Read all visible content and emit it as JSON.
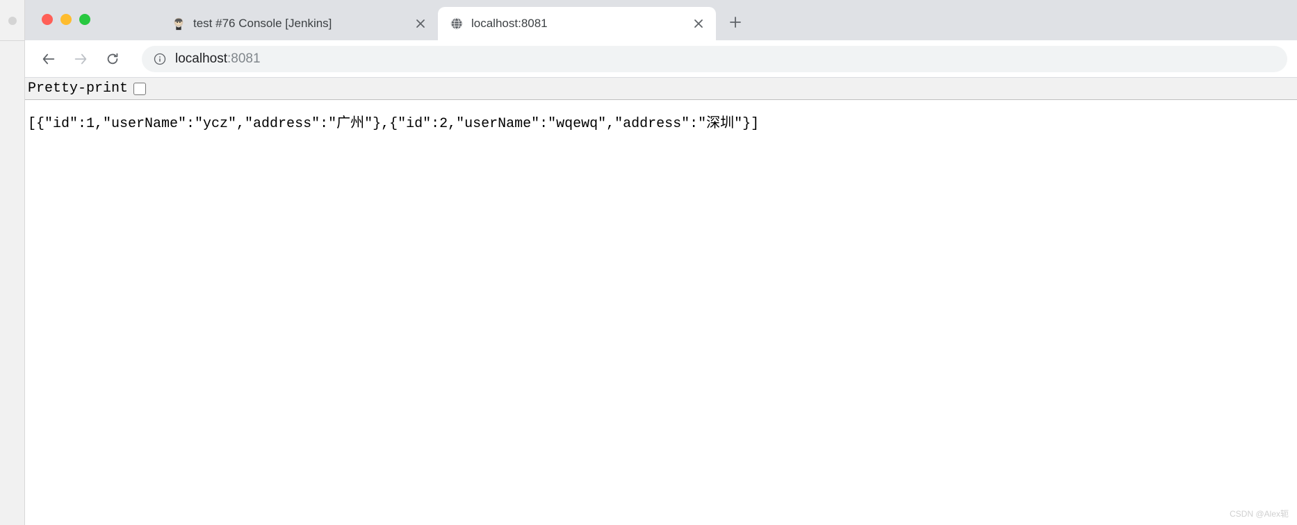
{
  "tabs": [
    {
      "title": "test #76 Console [Jenkins]",
      "active": false,
      "favicon_name": "jenkins-icon"
    },
    {
      "title": "localhost:8081",
      "active": true,
      "favicon_name": "globe-icon"
    }
  ],
  "toolbar": {
    "url_host": "localhost",
    "url_port": ":8081"
  },
  "pretty_print": {
    "label": "Pretty-print",
    "checked": false
  },
  "body_content": "[{\"id\":1,\"userName\":\"ycz\",\"address\":\"广州\"},{\"id\":2,\"userName\":\"wqewq\",\"address\":\"深圳\"}]",
  "watermark": "CSDN @Alex轭"
}
